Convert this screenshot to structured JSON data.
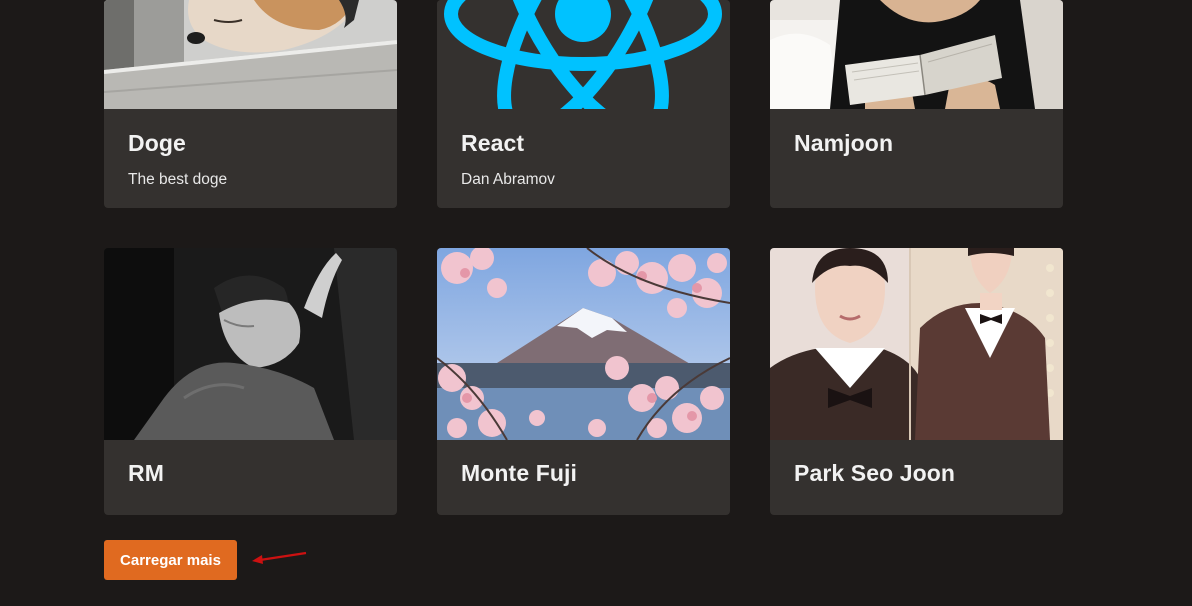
{
  "cards": [
    {
      "title": "Doge",
      "subtitle": "The best doge"
    },
    {
      "title": "React",
      "subtitle": "Dan Abramov"
    },
    {
      "title": "Namjoon",
      "subtitle": ""
    },
    {
      "title": "RM",
      "subtitle": ""
    },
    {
      "title": "Monte Fuji",
      "subtitle": ""
    },
    {
      "title": "Park Seo Joon",
      "subtitle": ""
    }
  ],
  "load_more": {
    "label": "Carregar mais"
  },
  "colors": {
    "background": "#1c1918",
    "card": "#34312f",
    "accent": "#e06a20",
    "react_blue": "#00c2ff",
    "annotation_arrow": "#cc1111"
  },
  "icons": {
    "annotation": "arrow-icon"
  }
}
